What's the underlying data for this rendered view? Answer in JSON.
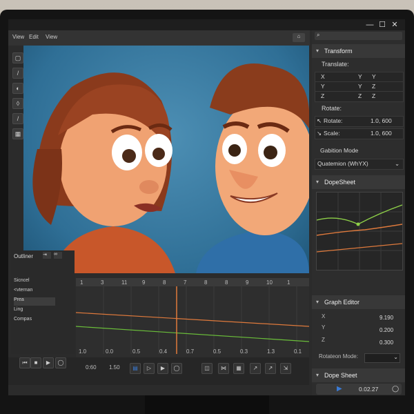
{
  "window": {
    "minimize": "—",
    "maximize": "☐",
    "close": "✕"
  },
  "menu": {
    "view": "View",
    "edit": "Edit",
    "view2": "View"
  },
  "transform": {
    "title": "Transform",
    "translate_label": "Translate:",
    "grid": [
      [
        "X",
        "Y",
        "Y"
      ],
      [
        "Y",
        "Y",
        "Z"
      ],
      [
        "Z",
        "Z",
        "Z"
      ]
    ],
    "rotate_label": "Rotate:",
    "rotate_row_label": "Rotate:",
    "rotate_value": "1.0, 600",
    "scale_label": "Scale:",
    "scale_value": "1.0, 600",
    "rotation_mode_label": "Gabition Mode",
    "rotation_mode_value": "Quatemion (WhYX)"
  },
  "dopesheet": {
    "title": "DopeSheet"
  },
  "graph_editor": {
    "title": "Graph Editor",
    "x_label": "X",
    "x_value": "9.190",
    "y_label": "Y",
    "y_value": "0.200",
    "z_label": "Z",
    "z_value": "0.300",
    "rotation_mode_label": "Rotateon Mode:"
  },
  "dopesheet2": {
    "title": "Dope Sheet"
  },
  "timecode": "0.02.27",
  "outliner": {
    "title": "Outliner",
    "items": [
      "Sicncel",
      "<vternan",
      "Prea",
      "Ling",
      "Compas"
    ]
  },
  "timeline": {
    "frame_numbers": [
      "1",
      "3",
      "11",
      "9",
      "8",
      "7",
      "8",
      "8",
      "9",
      "10",
      "1"
    ],
    "bottom_numbers": [
      "1.0",
      "0.0",
      "0.5",
      "0.4",
      "0.7",
      "0.5",
      "0.3",
      "1.3",
      "0.1"
    ],
    "controls_numbers": [
      "0:60",
      "1.50"
    ]
  },
  "colors": {
    "orange": "#e07a3c",
    "green": "#6bbf3a",
    "accent": "#3a7bd5"
  }
}
